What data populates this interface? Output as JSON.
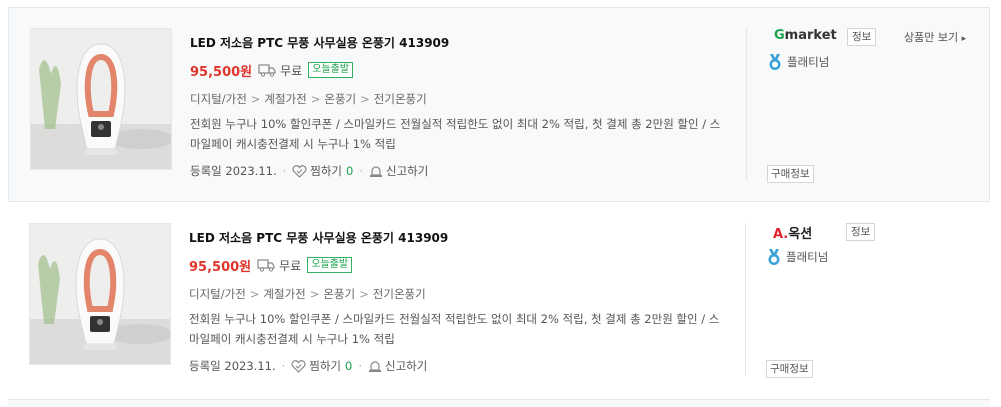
{
  "products": [
    {
      "title": "LED 저소음 PTC 무풍 사무실용 온풍기 413909",
      "price": "95,500원",
      "shipping": "무료",
      "badge": "오늘출발",
      "categories": [
        "디지털/가전",
        "계절가전",
        "온풍기",
        "전기온풍기"
      ],
      "description": "전회원 누구나 10% 할인쿠폰 / 스마일카드 전월실적 적립한도 없이 최대 2% 적립, 첫 결제 총 2만원 할인 / 스마일페이 캐시충전결제 시 누구나 1% 적립",
      "registered": "등록일 2023.11.",
      "wish_label": "찜하기",
      "wish_count": "0",
      "report_label": "신고하기",
      "seller": {
        "logo_g": "G",
        "logo_rest": "market",
        "info_label": "정보",
        "only_label": "상품만 보기",
        "grade": "플래티넘",
        "buy_info": "구매정보"
      }
    },
    {
      "title": "LED 저소음 PTC 무풍 사무실용 온풍기 413909",
      "price": "95,500원",
      "shipping": "무료",
      "badge": "오늘출발",
      "categories": [
        "디지털/가전",
        "계절가전",
        "온풍기",
        "전기온풍기"
      ],
      "description": "전회원 누구나 10% 할인쿠폰 / 스마일카드 전월실적 적립한도 없이 최대 2% 적립, 첫 결제 총 2만원 할인 / 스마일페이 캐시충전결제 시 누구나 1% 적립",
      "registered": "등록일 2023.11.",
      "wish_label": "찜하기",
      "wish_count": "0",
      "report_label": "신고하기",
      "seller": {
        "logo_a": "A.",
        "logo_rest": "옥션",
        "info_label": "정보",
        "grade": "플래티넘",
        "buy_info": "구매정보"
      }
    }
  ],
  "colors": {
    "price": "#e0352b",
    "badge": "#1aa34a",
    "gmarket_g": "#1aa34a",
    "auction_a": "#e4212a",
    "platinum": "#3aa0d8"
  },
  "separator": ">"
}
